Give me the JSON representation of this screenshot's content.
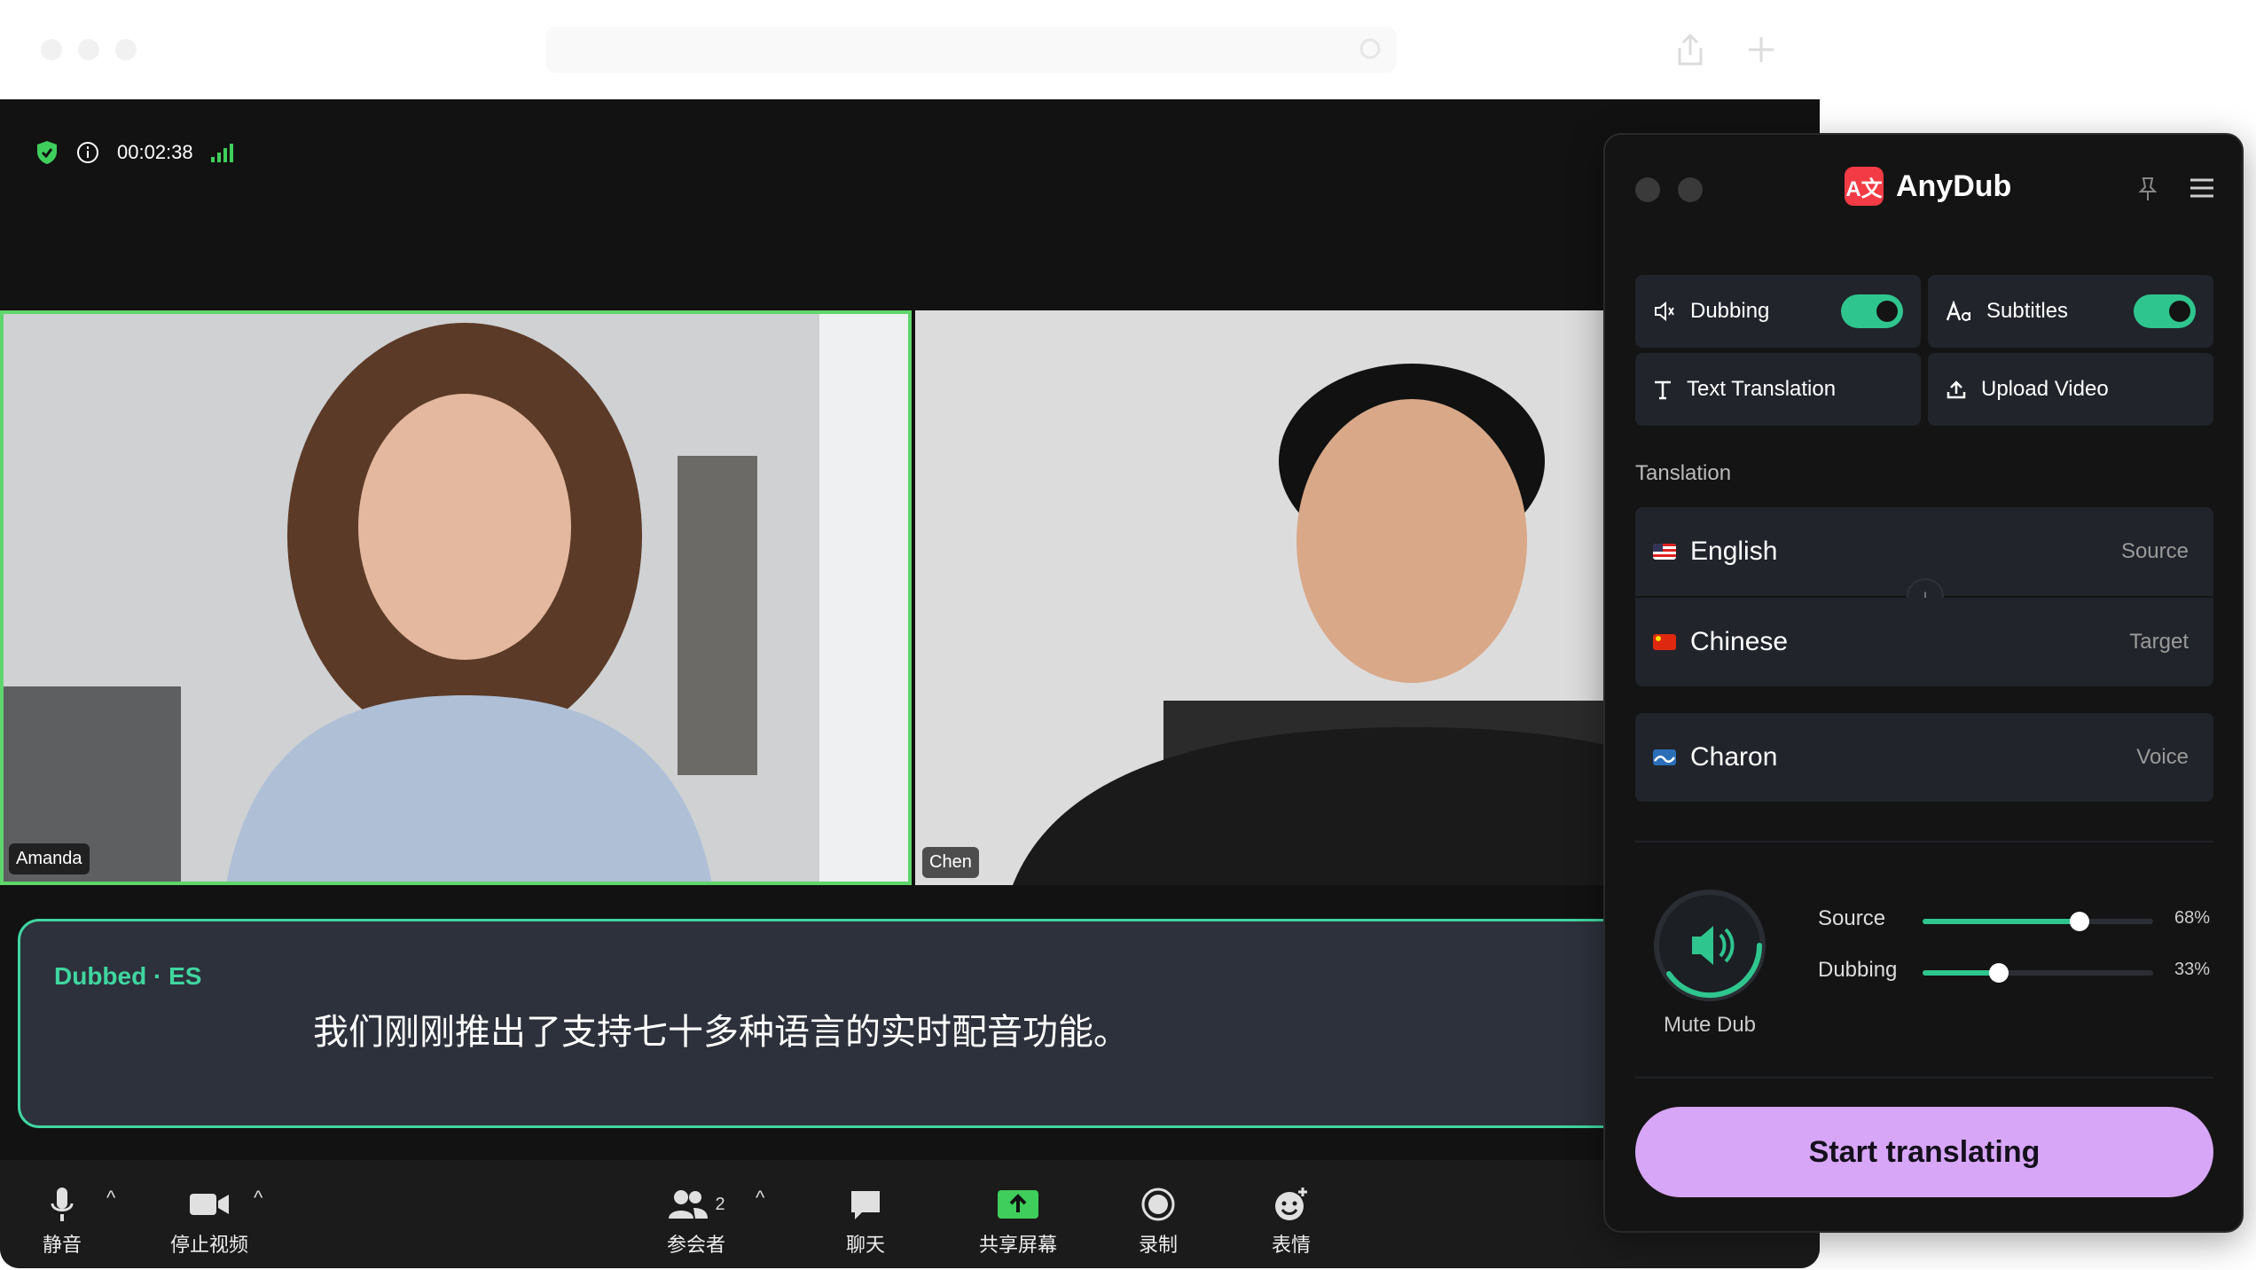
{
  "meeting": {
    "timer": "00:02:38",
    "participants": [
      {
        "name": "Amanda"
      },
      {
        "name": "Chen"
      }
    ],
    "subtitle": {
      "label": "Dubbed · ES",
      "text": "我们刚刚推出了支持七十多种语言的实时配音功能。"
    },
    "toolbar": {
      "mute": "静音",
      "stop_video": "停止视频",
      "participants": "参会者",
      "participant_count": "2",
      "chat": "聊天",
      "share_screen": "共享屏幕",
      "record": "录制",
      "reactions": "表情"
    }
  },
  "anydub": {
    "brand": "AnyDub",
    "logo_glyph": "A文",
    "features": {
      "dubbing": "Dubbing",
      "subtitles": "Subtitles",
      "text_translation": "Text Translation",
      "upload_video": "Upload Video",
      "dubbing_enabled": true,
      "subtitles_enabled": true
    },
    "section_label": "Tanslation",
    "source": {
      "language": "English",
      "role": "Source"
    },
    "target": {
      "language": "Chinese",
      "role": "Target"
    },
    "voice": {
      "name": "Charon",
      "role": "Voice"
    },
    "mixer": {
      "mute_label": "Mute Dub",
      "source_label": "Source",
      "source_pct": "68%",
      "source_level": 0.68,
      "dubbing_label": "Dubbing",
      "dubbing_pct": "33%",
      "dubbing_level": 0.33
    },
    "start_button": "Start translating"
  },
  "colors": {
    "accent_green": "#2fc58e",
    "speaker_border": "#5fd66b",
    "start_button": "#d7a6f7",
    "brand_red": "#f23b45"
  }
}
